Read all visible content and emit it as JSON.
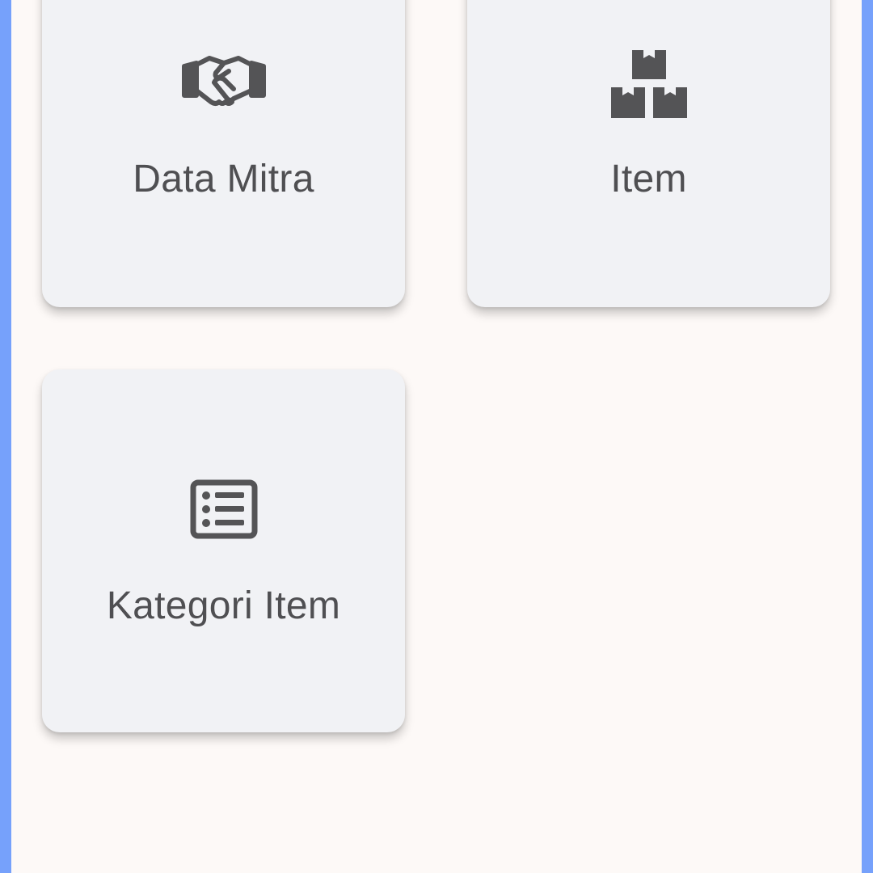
{
  "menu": {
    "cards": [
      {
        "label": "Data Mitra",
        "icon": "handshake-icon"
      },
      {
        "label": "Item",
        "icon": "boxes-icon"
      },
      {
        "label": "Kategori Item",
        "icon": "list-icon"
      }
    ]
  },
  "colors": {
    "frame": "#76a1fb",
    "background": "#fdf9f7",
    "card": "#f1f2f5",
    "icon": "#545456",
    "text": "#4f4f52"
  }
}
